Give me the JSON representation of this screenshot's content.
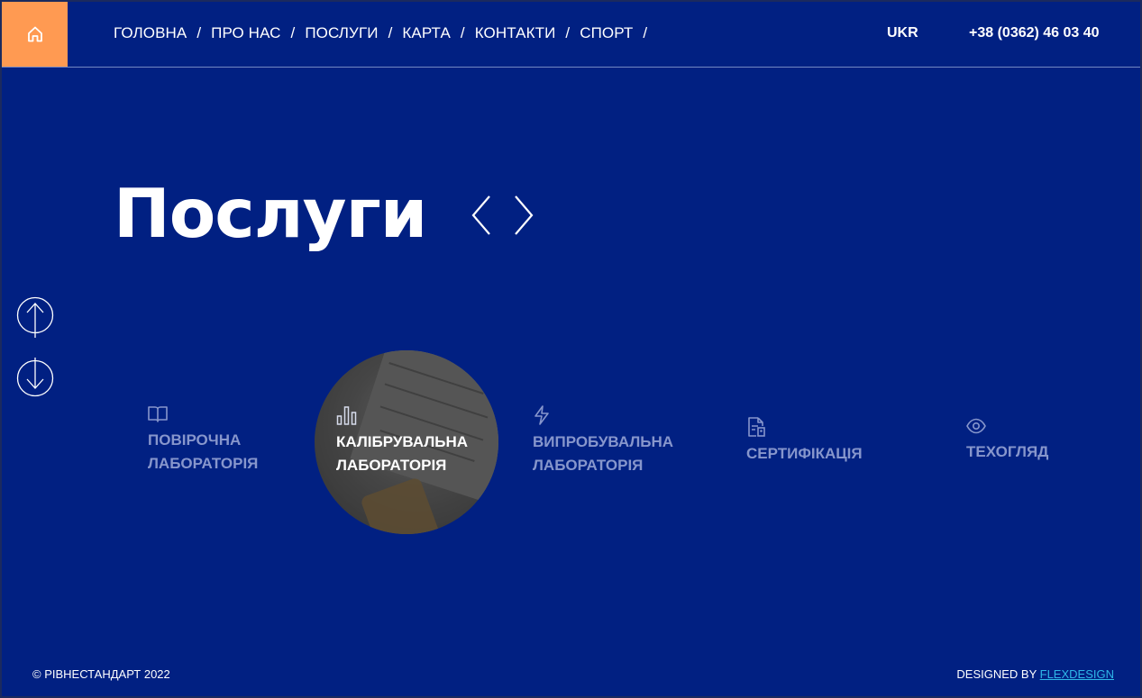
{
  "header": {
    "nav": [
      {
        "label": "ГОЛОВНА"
      },
      {
        "label": "ПРО НАС"
      },
      {
        "label": "ПОСЛУГИ"
      },
      {
        "label": "КАРТА"
      },
      {
        "label": "КОНТАКТИ"
      },
      {
        "label": "СПОРТ"
      }
    ],
    "separator": "/",
    "language": "UKR",
    "phone": "+38 (0362) 46 03 40"
  },
  "main": {
    "title": "Послуги",
    "services": [
      {
        "label": "ПОВІРОЧНА\nЛАБОРАТОРІЯ",
        "icon": "book-icon",
        "active": false
      },
      {
        "label": "КАЛІБРУВАЛЬНА\nЛАБОРАТОРІЯ",
        "icon": "bar-chart-icon",
        "active": true
      },
      {
        "label": "ВИПРОБУВАЛЬНА\nЛАБОРАТОРІЯ",
        "icon": "lightning-icon",
        "active": false
      },
      {
        "label": "СЕРТИФІКАЦІЯ",
        "icon": "document-icon",
        "active": false
      },
      {
        "label": "ТЕХОГЛЯД",
        "icon": "eye-icon",
        "active": false
      }
    ]
  },
  "footer": {
    "copyright": "© РІВНЕСТАНДАРТ 2022",
    "designed_by": "DESIGNED BY",
    "designer_link": "FLEXDESIGN"
  },
  "colors": {
    "background": "#012082",
    "accent": "#ff9a52",
    "inactive_text": "#8796cc",
    "link": "#2fb7e8"
  }
}
